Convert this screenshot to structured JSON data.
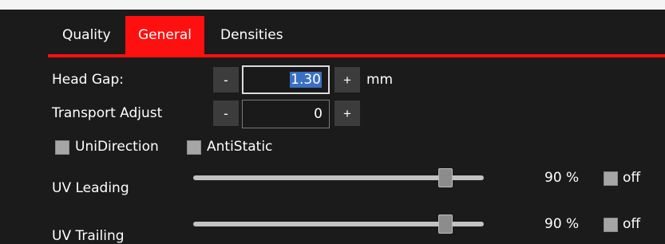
{
  "tabs": [
    {
      "label": "Quality"
    },
    {
      "label": "General"
    },
    {
      "label": "Densities"
    }
  ],
  "active_tab": "General",
  "head_gap": {
    "label": "Head Gap:",
    "value": "1.30",
    "unit": "mm",
    "minus": "-",
    "plus": "+"
  },
  "transport_adjust": {
    "label": "Transport Adjust",
    "value": "0",
    "minus": "-",
    "plus": "+"
  },
  "checkboxes": {
    "unidirection": {
      "label": "UniDirection",
      "checked": false
    },
    "antistatic": {
      "label": "AntiStatic",
      "checked": false
    }
  },
  "uv_leading": {
    "label": "UV Leading",
    "percent_text": "90 %",
    "level": 0.9,
    "off_label": "off",
    "off_checked": false
  },
  "uv_trailing": {
    "label": "UV Trailing",
    "percent_text": "90 %",
    "level": 0.9,
    "off_label": "off",
    "off_checked": false
  },
  "colors": {
    "accent": "#ff1010",
    "background": "#1b1b1b",
    "button": "#3c3c3c",
    "selection": "#3a6fc4"
  }
}
